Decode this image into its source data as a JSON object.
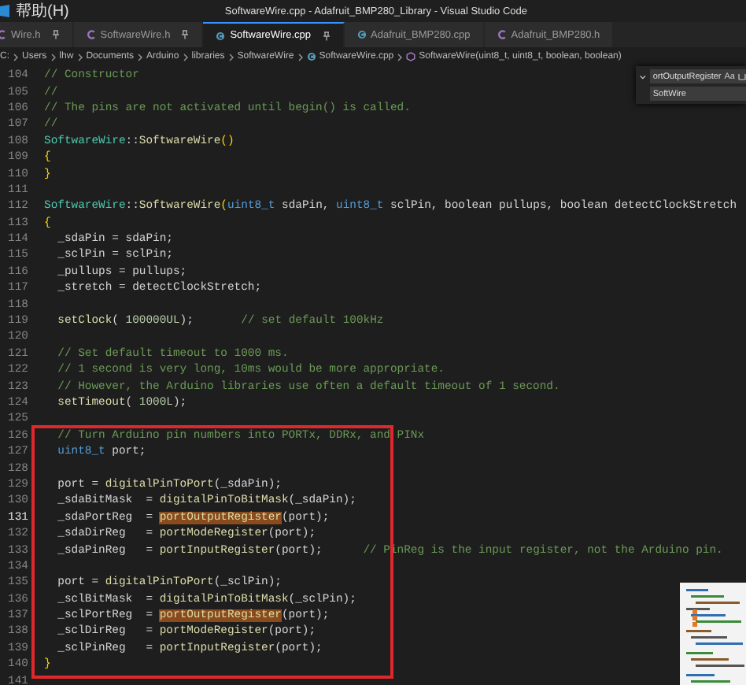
{
  "window": {
    "menu": [
      "帮助(H)"
    ],
    "title": "SoftwareWire.cpp - Adafruit_BMP280_Library - Visual Studio Code"
  },
  "tabs": [
    {
      "label": "Wire.h",
      "kind": "header",
      "pinned": true,
      "selected": false
    },
    {
      "label": "SoftwareWire.h",
      "kind": "header",
      "pinned": true,
      "selected": false
    },
    {
      "label": "SoftwareWire.cpp",
      "kind": "source",
      "pinned": true,
      "selected": true
    },
    {
      "label": "Adafruit_BMP280.cpp",
      "kind": "source",
      "pinned": false,
      "selected": false
    },
    {
      "label": "Adafruit_BMP280.h",
      "kind": "header",
      "pinned": false,
      "selected": false
    }
  ],
  "breadcrumb": [
    {
      "label": "C:",
      "kind": "folder"
    },
    {
      "label": "Users",
      "kind": "folder"
    },
    {
      "label": "lhw",
      "kind": "folder"
    },
    {
      "label": "Documents",
      "kind": "folder"
    },
    {
      "label": "Arduino",
      "kind": "folder"
    },
    {
      "label": "libraries",
      "kind": "folder"
    },
    {
      "label": "SoftwareWire",
      "kind": "folder"
    },
    {
      "label": "SoftwareWire.cpp",
      "kind": "source"
    },
    {
      "label": "SoftwareWire(uint8_t, uint8_t, boolean, boolean)",
      "kind": "method"
    }
  ],
  "find_widget": {
    "find": "ortOutputRegister",
    "match_case": "Aa",
    "replace": "SoftWire"
  },
  "code_lines": [
    {
      "number": "104",
      "current": false,
      "tokens": [
        {
          "kind": "comment",
          "text": "// Constructor"
        }
      ]
    },
    {
      "number": "105",
      "current": false,
      "tokens": [
        {
          "kind": "comment",
          "text": "//"
        }
      ]
    },
    {
      "number": "106",
      "current": false,
      "tokens": [
        {
          "kind": "comment",
          "text": "// The pins are not activated until begin() is called."
        }
      ]
    },
    {
      "number": "107",
      "current": false,
      "tokens": [
        {
          "kind": "comment",
          "text": "//"
        }
      ]
    },
    {
      "number": "108",
      "current": false,
      "tokens": [
        {
          "kind": "class",
          "text": "SoftwareWire"
        },
        {
          "kind": "plain",
          "text": "::"
        },
        {
          "kind": "function",
          "text": "SoftwareWire"
        },
        {
          "kind": "bracket",
          "text": "()"
        }
      ]
    },
    {
      "number": "109",
      "current": false,
      "tokens": [
        {
          "kind": "bracket",
          "text": "{"
        }
      ]
    },
    {
      "number": "110",
      "current": false,
      "tokens": [
        {
          "kind": "bracket",
          "text": "}"
        }
      ]
    },
    {
      "number": "111",
      "current": false
    },
    {
      "number": "112",
      "current": false,
      "tokens": [
        {
          "kind": "class",
          "text": "SoftwareWire"
        },
        {
          "kind": "plain",
          "text": "::"
        },
        {
          "kind": "function",
          "text": "SoftwareWire"
        },
        {
          "kind": "bracket",
          "text": "("
        },
        {
          "kind": "type",
          "text": "uint8_t"
        },
        {
          "kind": "plain",
          "text": " sdaPin, "
        },
        {
          "kind": "type",
          "text": "uint8_t"
        },
        {
          "kind": "plain",
          "text": " sclPin, boolean pullups, boolean detectClockStretch"
        }
      ]
    },
    {
      "number": "113",
      "current": false,
      "tokens": [
        {
          "kind": "bracket",
          "text": "{"
        }
      ]
    },
    {
      "number": "114",
      "current": false,
      "tokens": [
        {
          "kind": "plain",
          "text": "  _sdaPin = sdaPin;"
        }
      ]
    },
    {
      "number": "115",
      "current": false,
      "tokens": [
        {
          "kind": "plain",
          "text": "  _sclPin = sclPin;"
        }
      ]
    },
    {
      "number": "116",
      "current": false,
      "tokens": [
        {
          "kind": "plain",
          "text": "  _pullups = pullups;"
        }
      ]
    },
    {
      "number": "117",
      "current": false,
      "tokens": [
        {
          "kind": "plain",
          "text": "  _stretch = detectClockStretch;"
        }
      ]
    },
    {
      "number": "118",
      "current": false
    },
    {
      "number": "119",
      "current": false,
      "tokens": [
        {
          "kind": "function",
          "text": "  setClock"
        },
        {
          "kind": "plain",
          "text": "( "
        },
        {
          "kind": "number",
          "text": "100000UL"
        },
        {
          "kind": "plain",
          "text": ");       "
        },
        {
          "kind": "comment",
          "text": "// set default 100kHz"
        }
      ]
    },
    {
      "number": "120",
      "current": false
    },
    {
      "number": "121",
      "current": false,
      "tokens": [
        {
          "kind": "comment",
          "text": "  // Set default timeout to 1000 ms."
        }
      ]
    },
    {
      "number": "122",
      "current": false,
      "tokens": [
        {
          "kind": "comment",
          "text": "  // 1 second is very long, 10ms would be more appropriate."
        }
      ]
    },
    {
      "number": "123",
      "current": false,
      "tokens": [
        {
          "kind": "comment",
          "text": "  // However, the Arduino libraries use often a default timeout of 1 second."
        }
      ]
    },
    {
      "number": "124",
      "current": false,
      "tokens": [
        {
          "kind": "function",
          "text": "  setTimeout"
        },
        {
          "kind": "plain",
          "text": "( "
        },
        {
          "kind": "number",
          "text": "1000L"
        },
        {
          "kind": "plain",
          "text": ");"
        }
      ]
    },
    {
      "number": "125",
      "current": false
    },
    {
      "number": "126",
      "current": false,
      "tokens": [
        {
          "kind": "comment",
          "text": "  // Turn Arduino pin numbers into PORTx, DDRx, and PINx"
        }
      ]
    },
    {
      "number": "127",
      "current": false,
      "tokens": [
        {
          "kind": "type",
          "text": "  uint8_t"
        },
        {
          "kind": "plain",
          "text": " port;"
        }
      ]
    },
    {
      "number": "128",
      "current": false
    },
    {
      "number": "129",
      "current": false,
      "tokens": [
        {
          "kind": "plain",
          "text": "  port = "
        },
        {
          "kind": "function",
          "text": "digitalPinToPort"
        },
        {
          "kind": "plain",
          "text": "(_sdaPin);"
        }
      ]
    },
    {
      "number": "130",
      "current": false,
      "tokens": [
        {
          "kind": "plain",
          "text": "  _sdaBitMask  = "
        },
        {
          "kind": "function",
          "text": "digitalPinToBitMask"
        },
        {
          "kind": "plain",
          "text": "(_sdaPin);"
        }
      ]
    },
    {
      "number": "131",
      "current": true,
      "tokens": [
        {
          "kind": "plain",
          "text": "  _sdaPortReg  = "
        },
        {
          "kind": "match",
          "text": "portOutputRegister"
        },
        {
          "kind": "plain",
          "text": "(port);"
        }
      ]
    },
    {
      "number": "132",
      "current": false,
      "tokens": [
        {
          "kind": "plain",
          "text": "  _sdaDirReg   = "
        },
        {
          "kind": "function",
          "text": "portModeRegister"
        },
        {
          "kind": "plain",
          "text": "(port);"
        }
      ]
    },
    {
      "number": "133",
      "current": false,
      "tokens": [
        {
          "kind": "plain",
          "text": "  _sdaPinReg   = "
        },
        {
          "kind": "function",
          "text": "portInputRegister"
        },
        {
          "kind": "plain",
          "text": "(port);      "
        },
        {
          "kind": "comment",
          "text": "// PinReg is the input register, not the Arduino pin."
        }
      ]
    },
    {
      "number": "134",
      "current": false
    },
    {
      "number": "135",
      "current": false,
      "tokens": [
        {
          "kind": "plain",
          "text": "  port = "
        },
        {
          "kind": "function",
          "text": "digitalPinToPort"
        },
        {
          "kind": "plain",
          "text": "(_sclPin);"
        }
      ]
    },
    {
      "number": "136",
      "current": false,
      "tokens": [
        {
          "kind": "plain",
          "text": "  _sclBitMask  = "
        },
        {
          "kind": "function",
          "text": "digitalPinToBitMask"
        },
        {
          "kind": "plain",
          "text": "(_sclPin);"
        }
      ]
    },
    {
      "number": "137",
      "current": false,
      "tokens": [
        {
          "kind": "plain",
          "text": "  _sclPortReg  = "
        },
        {
          "kind": "match",
          "text": "portOutputRegister"
        },
        {
          "kind": "plain",
          "text": "(port);"
        }
      ]
    },
    {
      "number": "138",
      "current": false,
      "tokens": [
        {
          "kind": "plain",
          "text": "  _sclDirReg   = "
        },
        {
          "kind": "function",
          "text": "portModeRegister"
        },
        {
          "kind": "plain",
          "text": "(port);"
        }
      ]
    },
    {
      "number": "139",
      "current": false,
      "tokens": [
        {
          "kind": "plain",
          "text": "  _sclPinReg   = "
        },
        {
          "kind": "function",
          "text": "portInputRegister"
        },
        {
          "kind": "plain",
          "text": "(port);"
        }
      ]
    },
    {
      "number": "140",
      "current": false,
      "tokens": [
        {
          "kind": "bracket",
          "text": "}"
        }
      ]
    },
    {
      "number": "141",
      "current": false
    }
  ]
}
